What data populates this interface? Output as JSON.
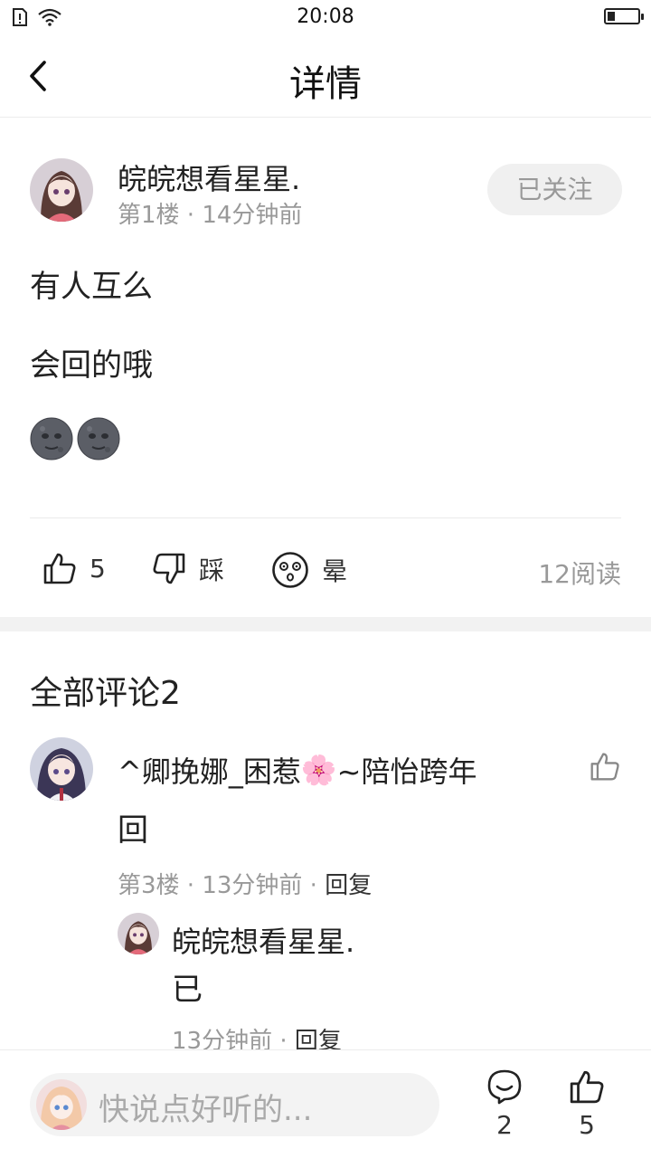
{
  "status_bar": {
    "time": "20:08",
    "battery_level": 0.25
  },
  "header": {
    "title": "详情",
    "back_icon": "chevron-left-icon"
  },
  "post": {
    "author_name": "皖皖想看星星.",
    "meta": "第1楼 · 14分钟前",
    "follow_label": "已关注",
    "lines": [
      "有人互么",
      "会回的哦"
    ],
    "emojis": "🌚🌚",
    "actions": {
      "like_count": "5",
      "dislike_label": "踩",
      "dizzy_label": "晕",
      "reads": "12阅读"
    }
  },
  "comments": {
    "title": "全部评论2",
    "items": [
      {
        "name_part1": "^卿挽娜_困惹",
        "name_emoji": "🌸",
        "name_part2": "~陪怡跨年",
        "text": "回",
        "meta_prefix": "第3楼 · 13分钟前 · ",
        "reply_label": "回复",
        "replies": [
          {
            "name": "皖皖想看星星.",
            "text": "已",
            "meta_prefix": "13分钟前 · ",
            "reply_label": "回复"
          }
        ]
      }
    ]
  },
  "bottom_bar": {
    "placeholder": "快说点好听的...",
    "comment_count": "2",
    "like_count": "5"
  },
  "colors": {
    "muted": "#999999",
    "text": "#222222",
    "pill": "#f0f0f0"
  }
}
